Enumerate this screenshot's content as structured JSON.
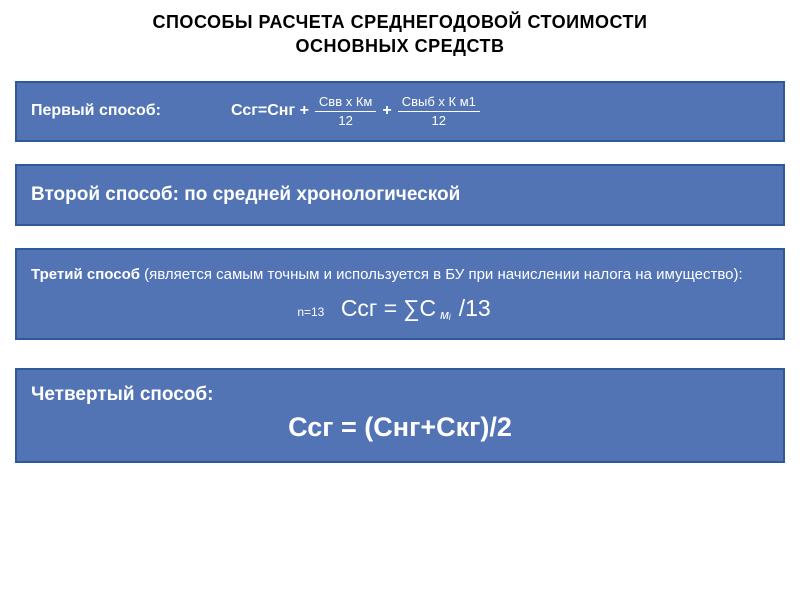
{
  "title_line1": "СПОСОБЫ РАСЧЕТА  СРЕДНЕГОДОВОЙ СТОИМОСТИ",
  "title_line2": "ОСНОВНЫХ СРЕДСТВ",
  "method1": {
    "label": "Первый способ:",
    "formula_prefix": "Ссг=Снг +",
    "frac1_num": "Свв х Км",
    "frac1_den": "12",
    "plus": "+",
    "frac2_num": "Свыб х К м1",
    "frac2_den": "12"
  },
  "method2": {
    "label": "Второй способ: по средней хронологической"
  },
  "method3": {
    "label_bold": "Третий способ",
    "label_rest": " (является самым точным и используется в БУ при начислении налога на имущество):",
    "n_annotation": "n=13",
    "formula_left": "Ссг =",
    "formula_sum": "∑С",
    "formula_sub": "мᵢ",
    "formula_right": "/13"
  },
  "method4": {
    "label": "Четвертый способ:",
    "formula": "Ссг = (Снг+Скг)/2"
  }
}
